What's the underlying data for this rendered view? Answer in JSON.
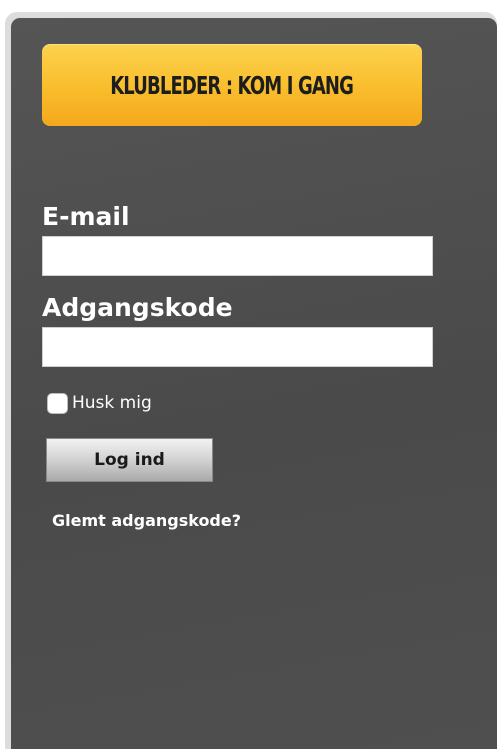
{
  "header": {
    "cta_label": "KLUBLEDER :  KOM I GANG"
  },
  "login_form": {
    "email_label": "E-mail",
    "email_value": "",
    "email_placeholder": "",
    "password_label": "Adgangskode",
    "password_value": "",
    "password_placeholder": "",
    "remember_label": "Husk mig",
    "remember_checked": false,
    "login_button_label": "Log ind",
    "forgot_password_label": "Glemt adgangskode?"
  },
  "colors": {
    "panel_background": "#4d4d4d",
    "cta_accent": "#f9bd2c",
    "text": "#ffffff"
  }
}
